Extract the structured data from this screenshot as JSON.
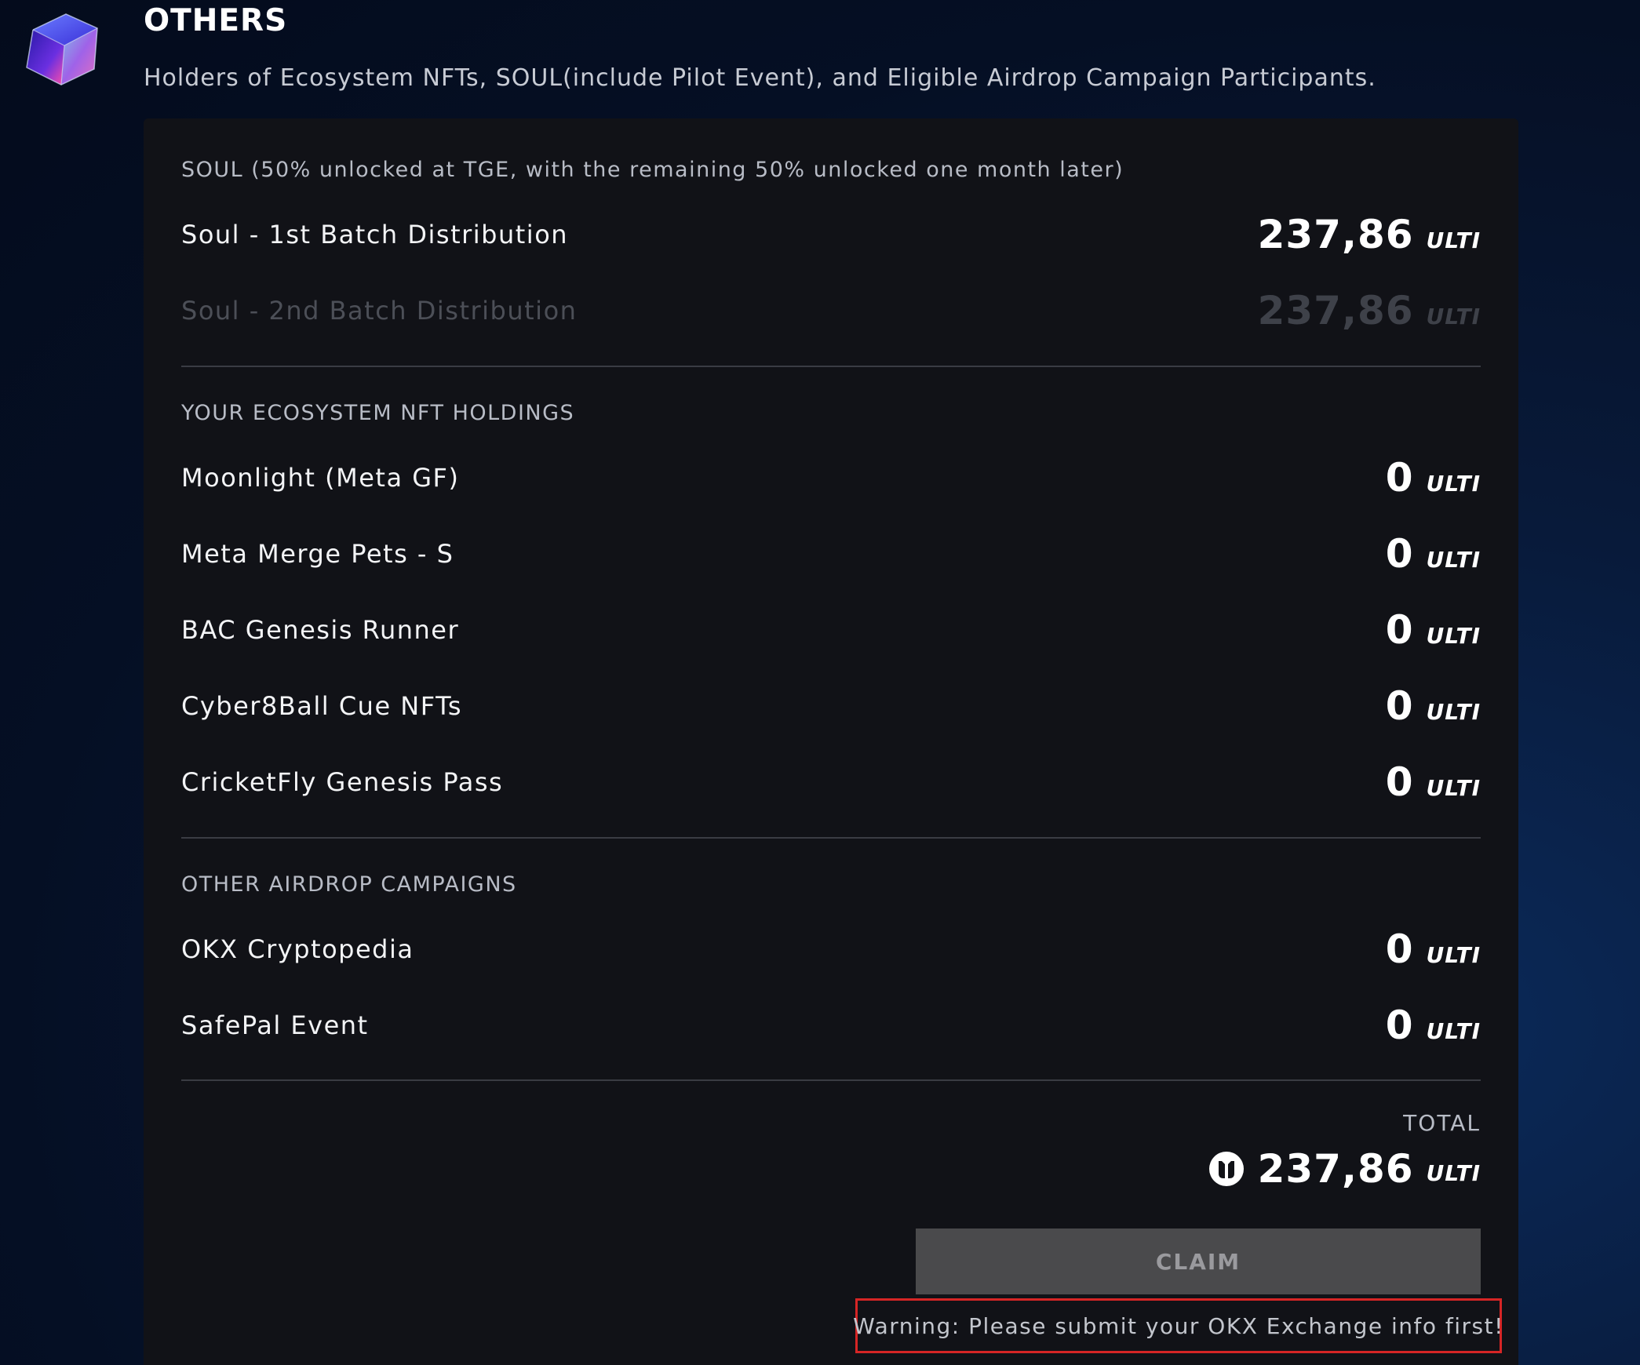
{
  "header": {
    "title": "OTHERS",
    "subtitle": "Holders of Ecosystem NFTs, SOUL(include Pilot Event), and Eligible Airdrop Campaign Participants."
  },
  "soul": {
    "label": "SOUL (50% unlocked at TGE, with the remaining 50% unlocked one month later)",
    "rows": [
      {
        "name": "Soul - 1st Batch Distribution",
        "amount": "237,86",
        "unit": "ULTI",
        "enabled": true
      },
      {
        "name": "Soul - 2nd Batch Distribution",
        "amount": "237,86",
        "unit": "ULTI",
        "enabled": false
      }
    ]
  },
  "nft": {
    "label": "YOUR ECOSYSTEM NFT HOLDINGS",
    "rows": [
      {
        "name": "Moonlight (Meta GF)",
        "amount": "0",
        "unit": "ULTI"
      },
      {
        "name": "Meta Merge Pets - S",
        "amount": "0",
        "unit": "ULTI"
      },
      {
        "name": "BAC Genesis Runner",
        "amount": "0",
        "unit": "ULTI"
      },
      {
        "name": "Cyber8Ball Cue NFTs",
        "amount": "0",
        "unit": "ULTI"
      },
      {
        "name": "CricketFly Genesis Pass",
        "amount": "0",
        "unit": "ULTI"
      }
    ]
  },
  "airdrop": {
    "label": "OTHER AIRDROP CAMPAIGNS",
    "rows": [
      {
        "name": "OKX Cryptopedia",
        "amount": "0",
        "unit": "ULTI"
      },
      {
        "name": "SafePal Event",
        "amount": "0",
        "unit": "ULTI"
      }
    ]
  },
  "total": {
    "label": "TOTAL",
    "amount": "237,86",
    "unit": "ULTI",
    "icon": "ulti-token-icon"
  },
  "claim": {
    "label": "CLAIM",
    "disabled": true
  },
  "warning": {
    "text": "Warning: Please submit your OKX Exchange info first!",
    "border_color": "#d62525"
  },
  "colors": {
    "card_bg": "#111217",
    "button_bg": "#4a4a4c",
    "muted_text": "#b8bcc6"
  }
}
